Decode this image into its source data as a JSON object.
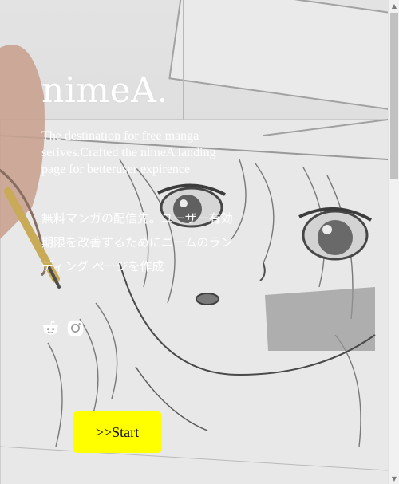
{
  "brand": {
    "logo": "nimeA."
  },
  "hero": {
    "description_en": "The destination for free manga serives.Crafted the nimeA landing page for betteruser expirence",
    "description_jp": "無料マンガの配信先。ユーザー有効期限を改善するためにニームのランディング ページを作成",
    "background_icon": "manga-sketch-illustration"
  },
  "social": {
    "items": [
      {
        "name": "reddit",
        "icon": "reddit-icon"
      },
      {
        "name": "instagram",
        "icon": "instagram-icon"
      }
    ]
  },
  "cta": {
    "start_label": ">>Start",
    "color": "#ffff00"
  },
  "scrollbar": {
    "up_arrow": "▲",
    "down_arrow": "▼"
  }
}
